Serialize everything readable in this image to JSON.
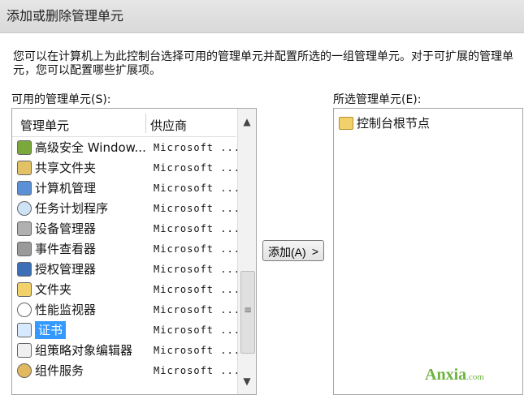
{
  "window": {
    "title": "添加或删除管理单元"
  },
  "description": "您可以在计算机上为此控制台选择可用的管理单元并配置所选的一组管理单元。对于可扩展的管理单元，您可以配置哪些扩展项。",
  "available_panel": {
    "label": "可用的管理单元(S):",
    "columns": [
      "管理单元",
      "供应商"
    ],
    "rows": [
      {
        "name": "高级安全 Window...",
        "vendor": "Microsoft ...",
        "icon": "shield-firewall-icon",
        "selected": false
      },
      {
        "name": "共享文件夹",
        "vendor": "Microsoft ...",
        "icon": "shared-folder-icon",
        "selected": false
      },
      {
        "name": "计算机管理",
        "vendor": "Microsoft ...",
        "icon": "computer-management-icon",
        "selected": false
      },
      {
        "name": "任务计划程序",
        "vendor": "Microsoft ...",
        "icon": "task-scheduler-icon",
        "selected": false
      },
      {
        "name": "设备管理器",
        "vendor": "Microsoft ...",
        "icon": "device-manager-icon",
        "selected": false
      },
      {
        "name": "事件查看器",
        "vendor": "Microsoft ...",
        "icon": "event-viewer-icon",
        "selected": false
      },
      {
        "name": "授权管理器",
        "vendor": "Microsoft ...",
        "icon": "authorization-manager-icon",
        "selected": false
      },
      {
        "name": "文件夹",
        "vendor": "Microsoft ...",
        "icon": "folder-icon",
        "selected": false
      },
      {
        "name": "性能监视器",
        "vendor": "Microsoft ...",
        "icon": "performance-monitor-icon",
        "selected": false
      },
      {
        "name": "证书",
        "vendor": "Microsoft ...",
        "icon": "certificates-icon",
        "selected": true
      },
      {
        "name": "组策略对象编辑器",
        "vendor": "Microsoft ...",
        "icon": "group-policy-icon",
        "selected": false
      },
      {
        "name": "组件服务",
        "vendor": "Microsoft ...",
        "icon": "component-services-icon",
        "selected": false
      }
    ]
  },
  "add_button": {
    "label": "添加(A)",
    "chevron": ">"
  },
  "selected_panel": {
    "label": "所选管理单元(E):",
    "items": [
      {
        "name": "控制台根节点",
        "icon": "folder-icon"
      }
    ]
  },
  "colors": {
    "selection": "#3399ff",
    "folder": "#f2d16b",
    "border": "#a6a6a6",
    "watermark": "#6db33f"
  },
  "watermark": {
    "text": "Anxia",
    "domain": ".com"
  }
}
